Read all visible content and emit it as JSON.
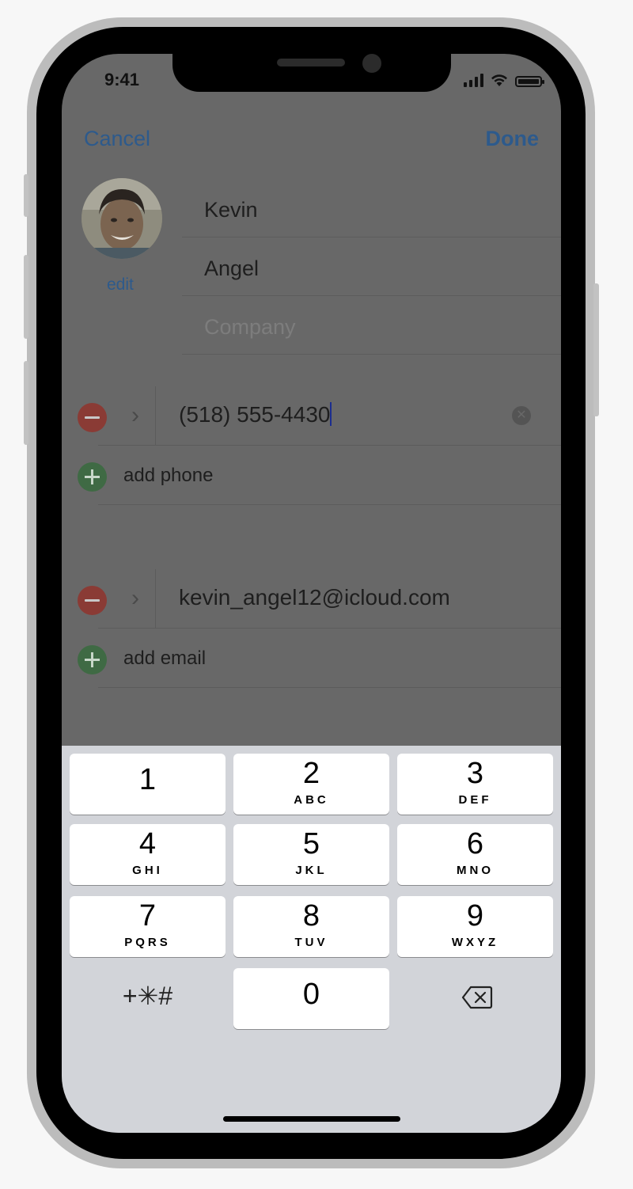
{
  "status_bar": {
    "time": "9:41"
  },
  "nav": {
    "cancel": "Cancel",
    "done": "Done"
  },
  "contact": {
    "edit_label": "edit",
    "first_name": "Kevin",
    "last_name": "Angel",
    "company_placeholder": "Company"
  },
  "phone": {
    "value": "(518) 555-4430",
    "add_label": "add phone"
  },
  "email": {
    "value": "kevin_angel12@icloud.com",
    "add_label": "add email"
  },
  "keypad": {
    "keys": [
      {
        "num": "1",
        "letters": ""
      },
      {
        "num": "2",
        "letters": "ABC"
      },
      {
        "num": "3",
        "letters": "DEF"
      },
      {
        "num": "4",
        "letters": "GHI"
      },
      {
        "num": "5",
        "letters": "JKL"
      },
      {
        "num": "6",
        "letters": "MNO"
      },
      {
        "num": "7",
        "letters": "PQRS"
      },
      {
        "num": "8",
        "letters": "TUV"
      },
      {
        "num": "9",
        "letters": "WXYZ"
      },
      {
        "num": "0",
        "letters": ""
      }
    ],
    "symbols": "+✳#"
  },
  "colors": {
    "link": "#2d5a8c",
    "keypad_bg": "#d2d4d9",
    "overlay": "#686868"
  }
}
